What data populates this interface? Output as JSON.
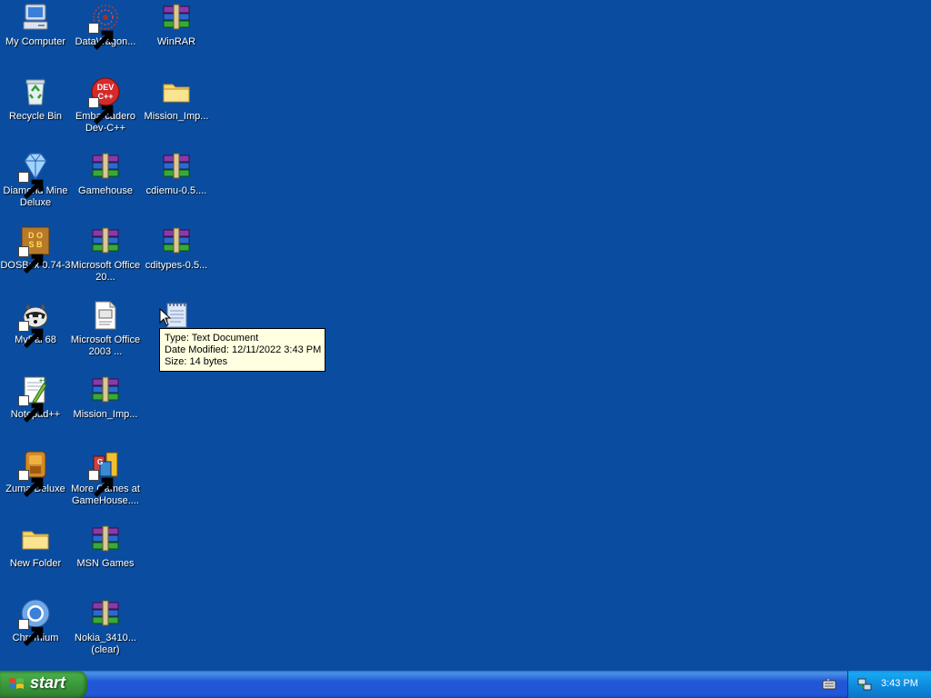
{
  "desktop": {
    "icons": [
      {
        "label": "My Computer",
        "icon": "my-computer-icon"
      },
      {
        "label": "DataWagon...",
        "icon": "datawagon-icon"
      },
      {
        "label": "WinRAR",
        "icon": "winrar-archive-icon"
      },
      {
        "label": "Recycle Bin",
        "icon": "recycle-bin-icon"
      },
      {
        "label": "Embarcadero Dev-C++",
        "icon": "devcpp-icon"
      },
      {
        "label": "Mission_Imp...",
        "icon": "folder-icon"
      },
      {
        "label": "Diamond Mine Deluxe",
        "icon": "diamond-icon"
      },
      {
        "label": "Gamehouse",
        "icon": "winrar-archive-icon"
      },
      {
        "label": "cdiemu-0.5....",
        "icon": "winrar-archive-icon"
      },
      {
        "label": "DOSBox 0.74-3",
        "icon": "dosbox-icon"
      },
      {
        "label": "Microsoft Office 20...",
        "icon": "winrar-archive-icon"
      },
      {
        "label": "cditypes-0.5...",
        "icon": "winrar-archive-icon"
      },
      {
        "label": "MyPal 68",
        "icon": "mypal-raccoon-icon"
      },
      {
        "label": "Microsoft Office 2003 ...",
        "icon": "text-document-icon"
      },
      {
        "label": "",
        "icon": "notepad-document-icon"
      },
      {
        "label": "Notepad++",
        "icon": "notepadpp-icon"
      },
      {
        "label": "Mission_Imp...",
        "icon": "winrar-archive-icon"
      },
      {
        "label": "Zuma Deluxe",
        "icon": "zuma-icon"
      },
      {
        "label": "More Games at GameHouse....",
        "icon": "gamehouse-icon"
      },
      {
        "label": "New Folder",
        "icon": "folder-icon"
      },
      {
        "label": "MSN Games",
        "icon": "winrar-archive-icon"
      },
      {
        "label": "Chromium",
        "icon": "chromium-icon"
      },
      {
        "label": "Nokia_3410... (clear)",
        "icon": "winrar-archive-icon"
      }
    ]
  },
  "tooltip": {
    "type": "Type: Text Document",
    "modified": "Date Modified: 12/11/2022 3:43 PM",
    "size": "Size: 14 bytes"
  },
  "taskbar": {
    "start_label": "start",
    "clock": "3:43 PM"
  },
  "colors": {
    "desktop_bg": "#0a4da0",
    "taskbar_blue": "#2157d7",
    "start_green": "#3b9a3b",
    "tooltip_bg": "#ffffe1"
  }
}
